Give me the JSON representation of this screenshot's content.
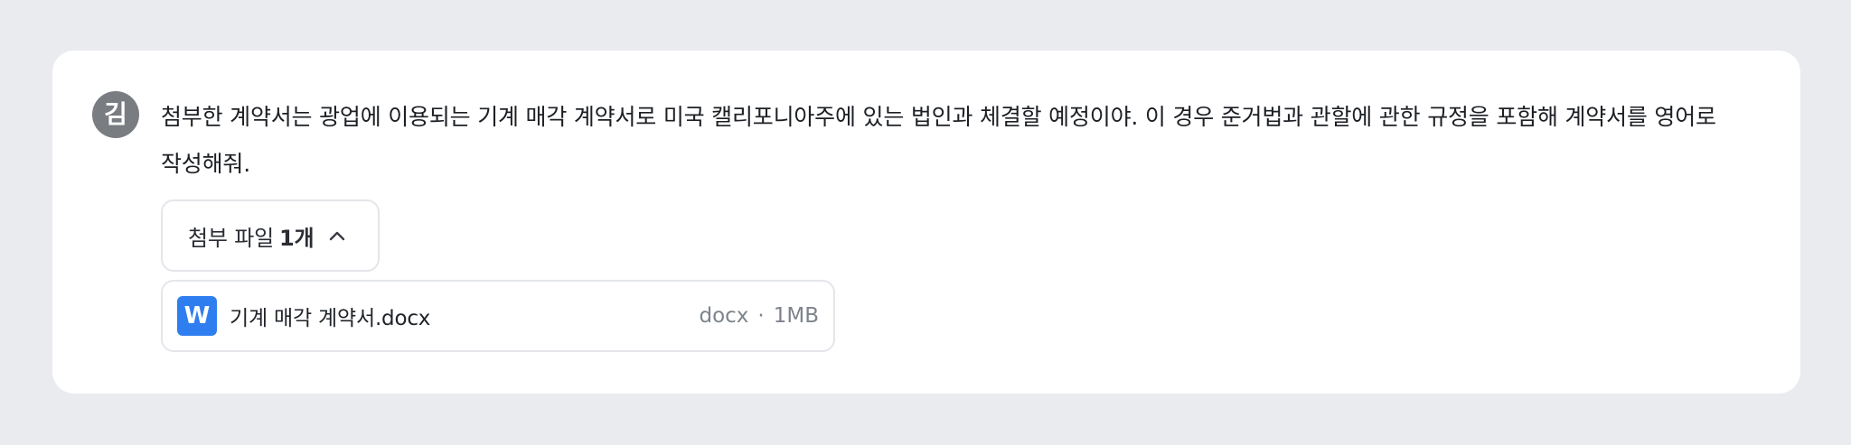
{
  "message": {
    "avatar_initial": "김",
    "text": "첨부한 계약서는 광업에 이용되는 기계 매각 계약서로 미국 캘리포니아주에 있는 법인과 체결할 예정이야. 이 경우 준거법과 관할에 관한 규정을 포함해 계약서를 영어로 작성해줘."
  },
  "attachments": {
    "toggle_label": "첨부 파일",
    "count_label": "1개",
    "toggle_icon": "chevron-up-icon",
    "files": [
      {
        "icon_letter": "W",
        "icon_name": "word-file-icon",
        "icon_color": "#2f7ef0",
        "name": "기계 매각 계약서.docx",
        "type": "docx",
        "separator": "·",
        "size": "1MB"
      }
    ]
  },
  "colors": {
    "page_background": "#e9ebef",
    "card_background": "#ffffff",
    "avatar_background": "#797c81",
    "border": "#e4e6ea"
  }
}
